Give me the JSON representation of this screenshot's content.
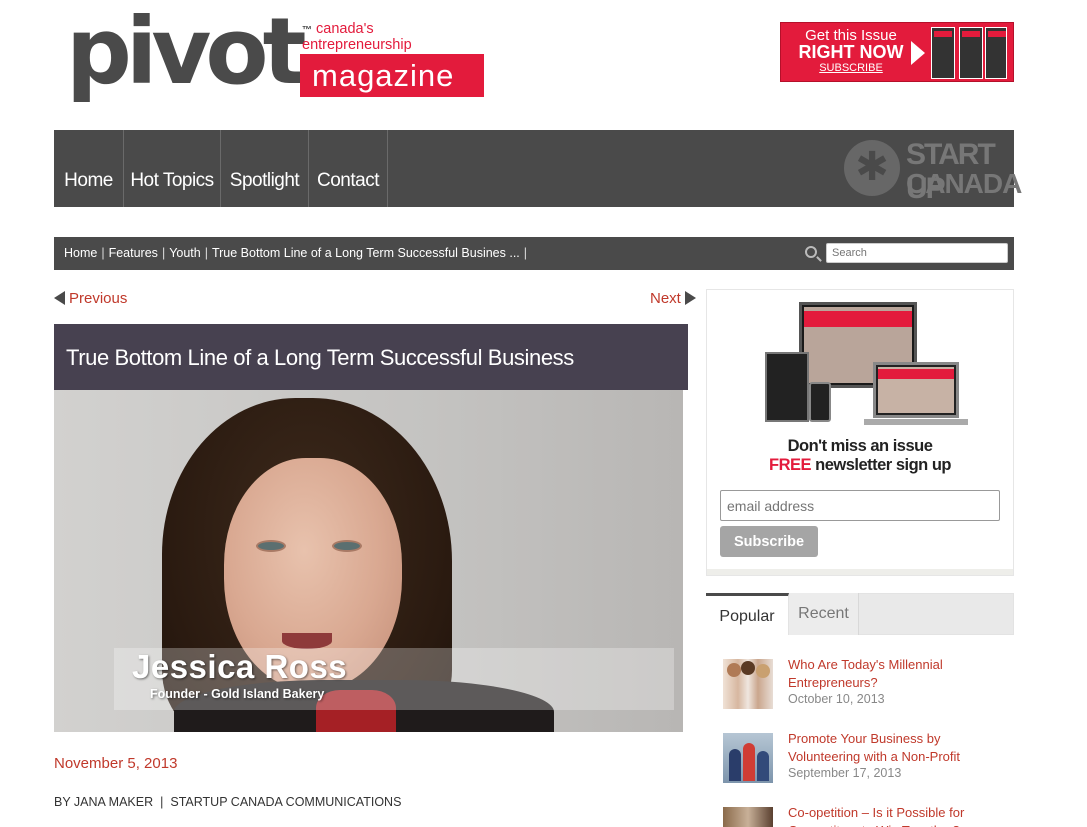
{
  "brand": {
    "wordmark": "pivot",
    "trademark": "™",
    "tagline_line1": "canada's",
    "tagline_line2": "entrepreneurship",
    "subtitle": "magazine",
    "accent_color": "#e31b3c",
    "nav_color": "#4a4a4a"
  },
  "ad": {
    "line1": "Get this Issue",
    "line2": "RIGHT NOW",
    "line3": "SUBSCRIBE"
  },
  "nav": {
    "items": [
      {
        "label": "Home"
      },
      {
        "label": "Hot Topics"
      },
      {
        "label": "Spotlight"
      },
      {
        "label": "Contact"
      }
    ],
    "partner_logo_line1": "START UP",
    "partner_logo_line2": "CANADA",
    "partner_logo_icon": "maple-leaf-icon"
  },
  "breadcrumb": {
    "items": [
      "Home",
      "Features",
      "Youth",
      "True Bottom Line of a Long Term Successful Busines ..."
    ],
    "separator": "|"
  },
  "search": {
    "placeholder": "Search"
  },
  "pager": {
    "previous": "Previous",
    "next": "Next"
  },
  "article": {
    "title": "True Bottom Line of a Long Term Successful Business",
    "video": {
      "name": "Jessica Ross",
      "role": "Founder - Gold Island Bakery"
    },
    "date": "November 5, 2013",
    "author": "BY JANA MAKER",
    "byline_separator": "|",
    "category": "STARTUP CANADA COMMUNICATIONS"
  },
  "newsletter": {
    "line1": "Don't miss an issue",
    "line2_highlight": "FREE",
    "line2_rest": " newsletter sign up",
    "email_placeholder": "email address",
    "button_label": "Subscribe"
  },
  "sidebar_tabs": {
    "tabs": [
      "Popular",
      "Recent"
    ],
    "active": "Popular",
    "posts": [
      {
        "title": "Who Are Today's Millennial Entrepreneurs?",
        "date": "October 10, 2013"
      },
      {
        "title": "Promote Your Business by Volunteering with a Non-Profit",
        "date": "September 17, 2013"
      },
      {
        "title": "Co-opetition – Is it Possible for Competitors to Win Together?",
        "date": ""
      }
    ]
  }
}
